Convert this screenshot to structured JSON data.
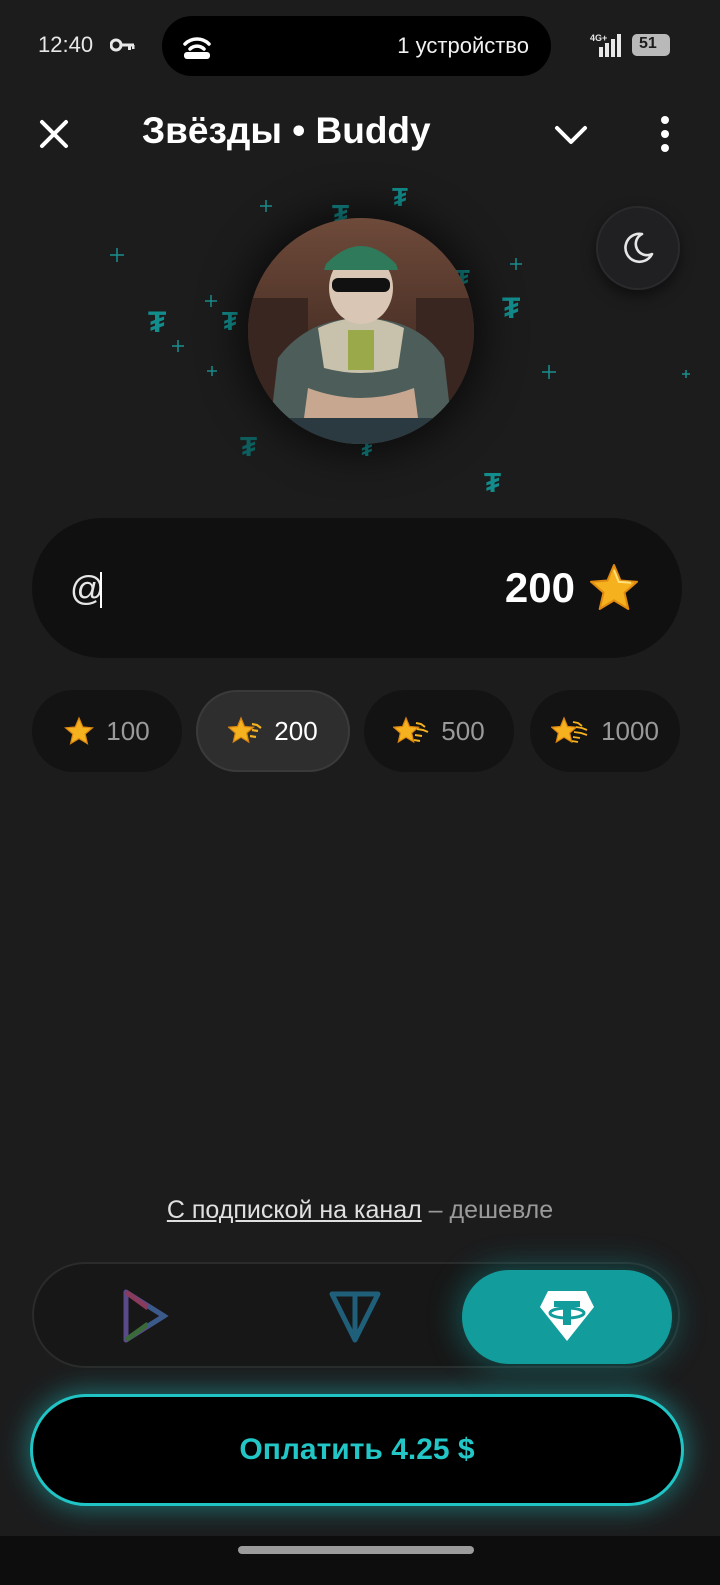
{
  "status_bar": {
    "time": "12:40",
    "island_text": "1 устройство",
    "battery": "51"
  },
  "header": {
    "title": "Звёзды • Buddy"
  },
  "input": {
    "prefix": "@",
    "amount": "200"
  },
  "chips": [
    {
      "label": "100",
      "selected": false
    },
    {
      "label": "200",
      "selected": true
    },
    {
      "label": "500",
      "selected": false
    },
    {
      "label": "1000",
      "selected": false
    }
  ],
  "promo": {
    "link": "С подпиской на канал",
    "suffix": " – дешевле"
  },
  "payment_methods": [
    {
      "icon": "stars-pay-icon",
      "selected": false
    },
    {
      "icon": "ton-icon",
      "selected": false
    },
    {
      "icon": "tether-usdt-icon",
      "selected": true
    }
  ],
  "pay_button": {
    "label": "Оплатить 4.25 $"
  },
  "colors": {
    "accent": "#20c4c4",
    "accent_fill": "#129c9c",
    "background": "#1c1c1d"
  }
}
